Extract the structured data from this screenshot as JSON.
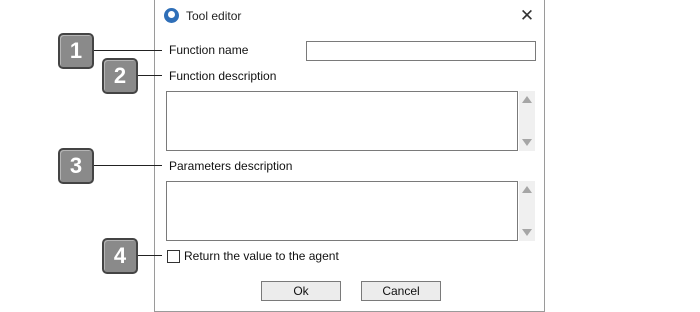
{
  "window": {
    "title": "Tool editor",
    "close_glyph": "✕"
  },
  "fields": {
    "function_name_label": "Function name",
    "function_name_value": "",
    "function_description_label": "Function description",
    "function_description_value": "",
    "parameters_description_label": "Parameters description",
    "parameters_description_value": ""
  },
  "checkbox": {
    "label": "Return the value to the agent",
    "checked": false
  },
  "buttons": {
    "ok": "Ok",
    "cancel": "Cancel"
  },
  "callouts": [
    "1",
    "2",
    "3",
    "4"
  ],
  "icons": {
    "app": "app-logo-icon",
    "close": "close-icon"
  },
  "colors": {
    "callout_fill": "#8a8a8a",
    "callout_border": "#444444",
    "window_border": "#9a9a9a"
  }
}
